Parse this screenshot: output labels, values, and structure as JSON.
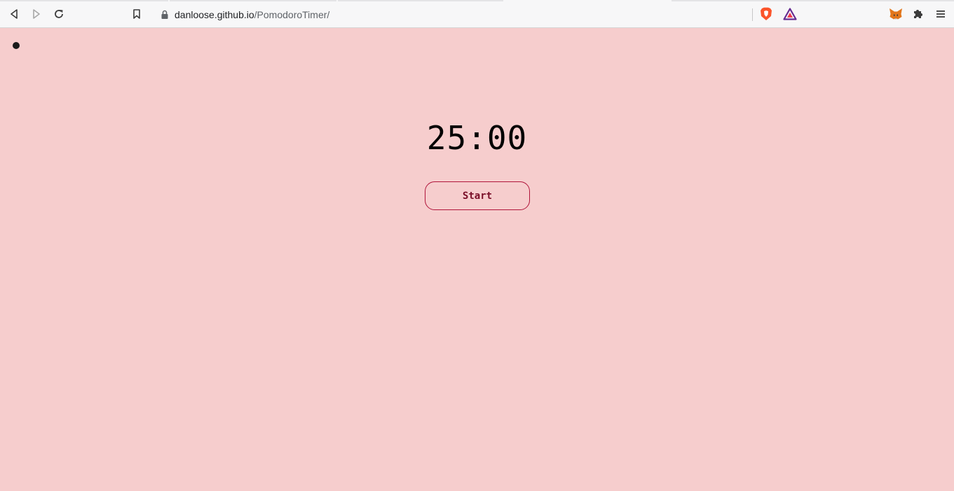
{
  "browser": {
    "url_host": "danloose.github.io",
    "url_path": "/PomodoroTimer/",
    "icons": [
      "back-icon",
      "forward-icon",
      "reload-icon",
      "bookmark-icon",
      "lock-icon",
      "brave-shields-icon",
      "brave-rewards-icon",
      "metamask-icon",
      "extensions-icon",
      "menu-icon"
    ]
  },
  "page": {
    "timer": "25:00",
    "start_label": "Start"
  },
  "colors": {
    "background": "#f6cdcd",
    "button_border": "#b0143a",
    "button_text": "#7a0f28"
  }
}
